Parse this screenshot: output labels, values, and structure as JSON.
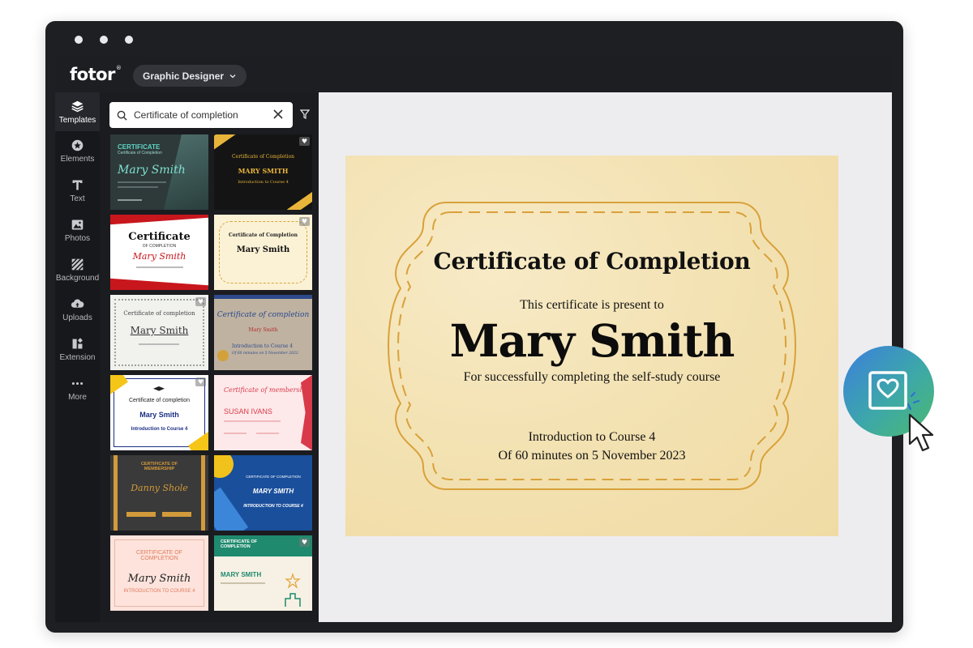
{
  "app": {
    "logo": "fotor",
    "logo_mark": "®",
    "mode_button": "Graphic Designer"
  },
  "rail": {
    "items": [
      {
        "label": "Templates",
        "icon": "layers-icon",
        "active": true
      },
      {
        "label": "Elements",
        "icon": "elements-icon"
      },
      {
        "label": "Text",
        "icon": "text-icon"
      },
      {
        "label": "Photos",
        "icon": "photos-icon"
      },
      {
        "label": "Background",
        "icon": "background-icon"
      },
      {
        "label": "Uploads",
        "icon": "cloud-upload-icon"
      },
      {
        "label": "Extension",
        "icon": "extension-icon"
      },
      {
        "label": "More",
        "icon": "more-icon"
      }
    ]
  },
  "search": {
    "value": "Certificate of completion"
  },
  "templates": [
    {
      "title": "CERTIFICATE",
      "subtitle": "Certificate of Completion",
      "name": "Mary Smith",
      "bg": "#2e3a3a",
      "accent": "#5fd3c4"
    },
    {
      "title": "Certificate of Completion",
      "name": "MARY SMITH",
      "course": "Introduction to Course 4",
      "bg": "#141414",
      "accent": "#e8b53a"
    },
    {
      "title": "Certificate",
      "subtitle": "OF COMPLETION",
      "name": "Mary Smith",
      "bg": "#ffffff",
      "accent": "#c8161d"
    },
    {
      "title": "Certificate of Completion",
      "name": "Mary Smith",
      "bg": "#fbf2d6",
      "accent": "#d6a53a"
    },
    {
      "title": "Certificate of completion",
      "name": "Mary Smith",
      "bg": "#f1f1ee",
      "accent": "#9aa39a"
    },
    {
      "title": "Certificate of completion",
      "name": "Mary Smith",
      "course": "Introduction to Course 4",
      "date": "Of 60 minutes on 5 November 2023",
      "bg": "#bfb2a1",
      "accent": "#2d4a8a"
    },
    {
      "title": "Certificate of completion",
      "name": "Mary Smith",
      "course": "Introduction to Course 4",
      "bg": "#ffffff",
      "accent": "#f5c518"
    },
    {
      "title": "Certificate of membership",
      "name": "SUSAN IVANS",
      "bg": "#fde9ea",
      "accent": "#d93a4a"
    },
    {
      "title": "CERTIFICATE OF MEMBERSHIP",
      "name": "Danny Shole",
      "bg": "#3a3a3a",
      "accent": "#d29a3b"
    },
    {
      "title": "CERTIFICATE OF COMPLETION",
      "name": "MARY SMITH",
      "course": "INTRODUCTION TO COURSE 4",
      "bg": "#1a4f9c",
      "accent": "#f2c21c"
    },
    {
      "title": "CERTIFICATE OF COMPLETION",
      "name": "Mary Smith",
      "course": "INTRODUCTION TO COURSE 4",
      "bg": "#fde3dc",
      "accent": "#e37b5b"
    },
    {
      "title": "CERTIFICATE OF COMPLETION",
      "name": "MARY SMITH",
      "bg": "#f6f1e4",
      "accent": "#1f8a6e"
    }
  ],
  "certificate": {
    "title": "Certificate of Completion",
    "present_text": "This certificate is present to",
    "name": "Mary Smith",
    "reason": "For successfully completing the self-study course",
    "course": "Introduction to Course 4",
    "date_line": "Of 60 minutes on 5 November 2023"
  },
  "colors": {
    "frame_gold": "#d9a13a",
    "window_dark": "#1e1f23"
  },
  "fab": {
    "icon": "heart-frame-icon"
  }
}
